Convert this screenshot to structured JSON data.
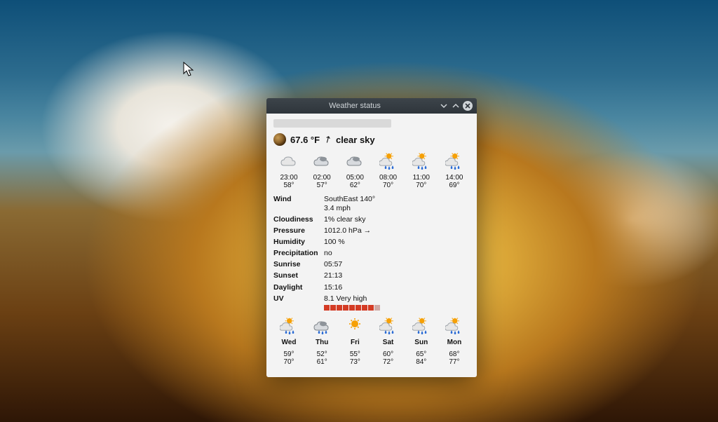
{
  "window": {
    "title": "Weather status"
  },
  "current": {
    "temp": "67.6 °F",
    "trend_glyph": "↗",
    "condition": "clear sky"
  },
  "hourly": [
    {
      "icon": "cloud",
      "time": "23:00",
      "temp": "58°"
    },
    {
      "icon": "cloud2",
      "time": "02:00",
      "temp": "57°"
    },
    {
      "icon": "cloud2",
      "time": "05:00",
      "temp": "62°"
    },
    {
      "icon": "sun-rain",
      "time": "08:00",
      "temp": "70°"
    },
    {
      "icon": "sun-rain",
      "time": "11:00",
      "temp": "70°"
    },
    {
      "icon": "sun-rain",
      "time": "14:00",
      "temp": "69°"
    }
  ],
  "details": {
    "wind": {
      "label": "Wind",
      "value": "SouthEast 140°\n3.4 mph"
    },
    "cloudiness": {
      "label": "Cloudiness",
      "value": "1% clear sky"
    },
    "pressure": {
      "label": "Pressure",
      "value": "1012.0 hPa →"
    },
    "humidity": {
      "label": "Humidity",
      "value": "100 %"
    },
    "precip": {
      "label": "Precipitation",
      "value": "no"
    },
    "sunrise": {
      "label": "Sunrise",
      "value": "05:57"
    },
    "sunset": {
      "label": "Sunset",
      "value": "21:13"
    },
    "daylight": {
      "label": "Daylight",
      "value": "15:16"
    },
    "uv": {
      "label": "UV",
      "value": "8.1 Very high",
      "blocks": 8,
      "total": 9
    }
  },
  "daily": [
    {
      "icon": "sun-rain",
      "day": "Wed",
      "lo": "59°",
      "hi": "70°"
    },
    {
      "icon": "rain",
      "day": "Thu",
      "lo": "52°",
      "hi": "61°"
    },
    {
      "icon": "sun",
      "day": "Fri",
      "lo": "55°",
      "hi": "73°"
    },
    {
      "icon": "sun-rain",
      "day": "Sat",
      "lo": "60°",
      "hi": "72°"
    },
    {
      "icon": "sun-rain",
      "day": "Sun",
      "lo": "65°",
      "hi": "84°"
    },
    {
      "icon": "sun-rain",
      "day": "Mon",
      "lo": "68°",
      "hi": "77°"
    }
  ]
}
